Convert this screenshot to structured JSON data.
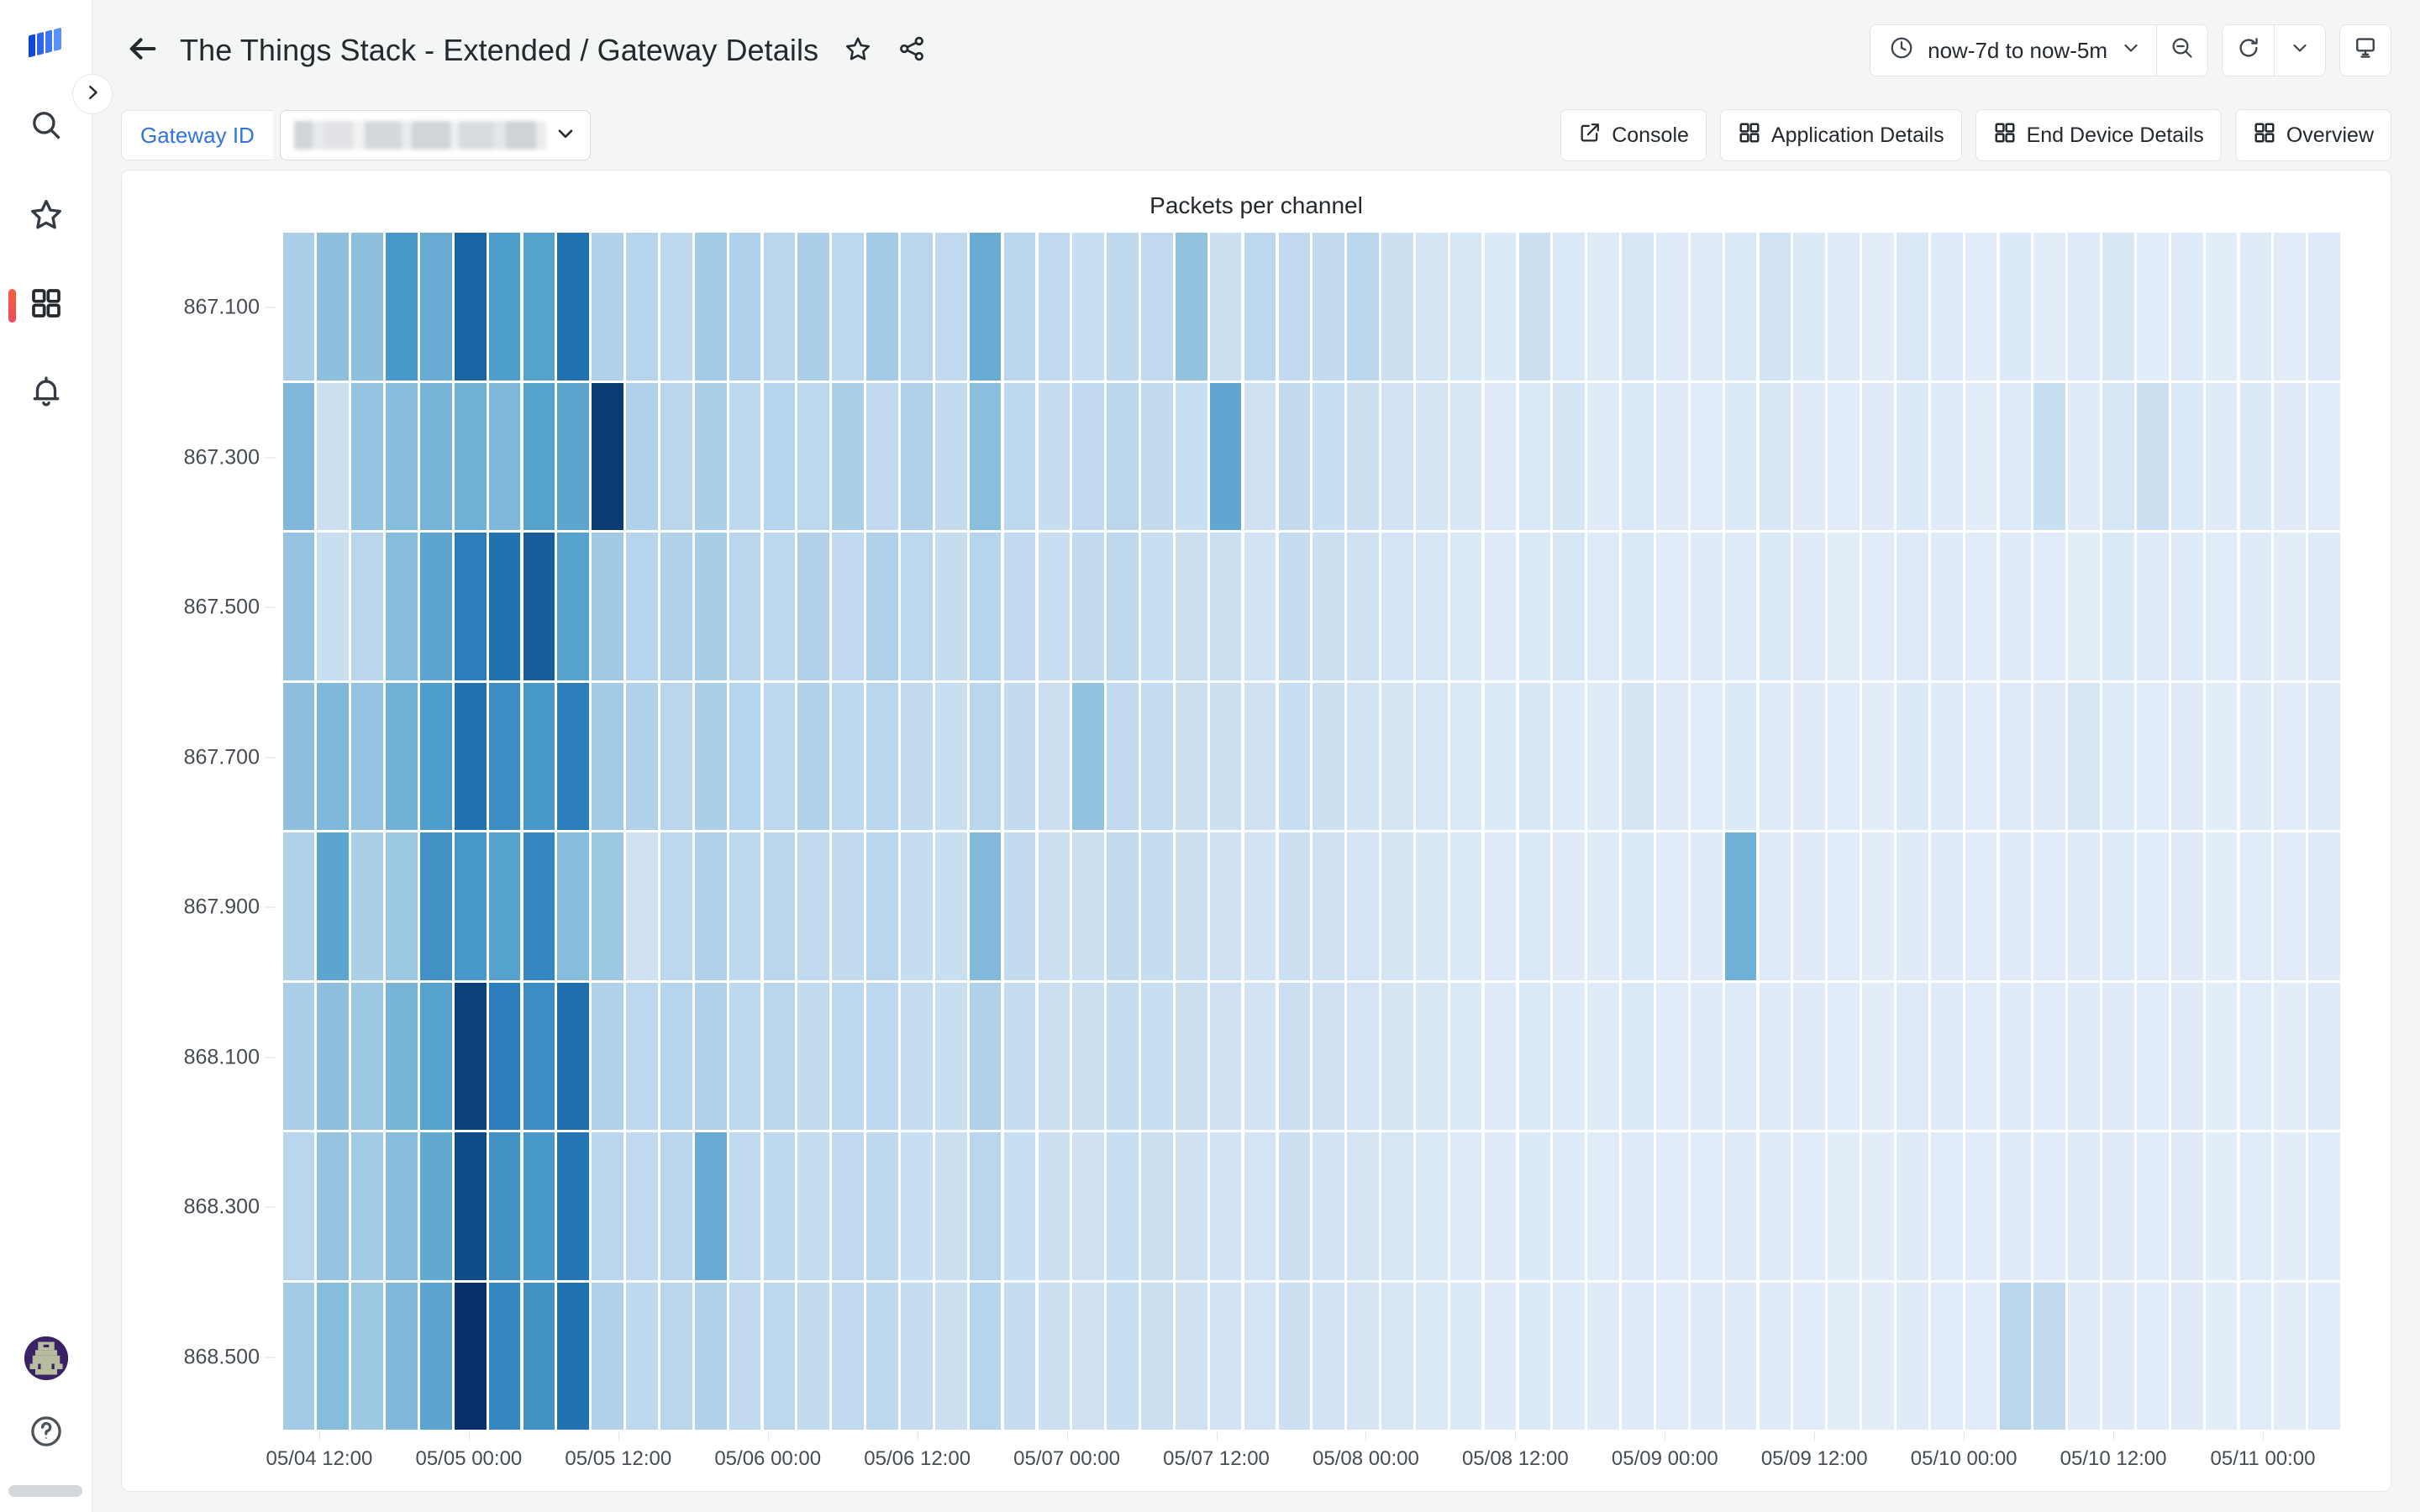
{
  "sidebar": {
    "logo": "grafana-logo",
    "items": [
      {
        "name": "search",
        "icon": "search-icon",
        "active": false
      },
      {
        "name": "starred",
        "icon": "star-icon",
        "active": false
      },
      {
        "name": "dashboards",
        "icon": "dashboards-icon",
        "active": true
      },
      {
        "name": "alerting",
        "icon": "bell-icon",
        "active": false
      }
    ],
    "bottom": [
      {
        "name": "profile",
        "icon": "avatar-icon"
      },
      {
        "name": "help",
        "icon": "help-circle-icon"
      }
    ]
  },
  "header": {
    "back_label": "back-arrow",
    "title": "The Things Stack - Extended  /  Gateway Details",
    "star_icon": "star-icon",
    "share_icon": "share-icon",
    "time_range": "now-7d to now-5m",
    "time_icon": "clock-icon",
    "time_caret": "chevron-down-icon",
    "zoom_out_icon": "zoom-out-icon",
    "refresh_icon": "refresh-icon",
    "refresh_caret": "chevron-down-icon",
    "tv_icon": "tv-mode-icon"
  },
  "toolbar": {
    "variable_label": "Gateway ID",
    "variable_value": "",
    "variable_caret": "chevron-down-icon",
    "links": [
      {
        "label": "Console",
        "icon": "external-link-icon"
      },
      {
        "label": "Application Details",
        "icon": "dashboard-grid-icon"
      },
      {
        "label": "End Device Details",
        "icon": "dashboard-grid-icon"
      },
      {
        "label": "Overview",
        "icon": "dashboard-grid-icon"
      }
    ]
  },
  "panel": {
    "title": "Packets per channel"
  },
  "chart_data": {
    "type": "heatmap",
    "title": "Packets per channel",
    "xlabel": "",
    "ylabel": "",
    "grid": false,
    "legend": "none",
    "color_scheme": "Blues",
    "color_stops": [
      "#f2f7fd",
      "#e3edf8",
      "#d2e3f3",
      "#b9d6ed",
      "#96c4e0",
      "#6fb0d6",
      "#4e9ecb",
      "#2f81bf",
      "#1e6ead",
      "#0c457f",
      "#08306b"
    ],
    "y_categories": [
      "867.100",
      "867.300",
      "867.500",
      "867.700",
      "867.900",
      "868.100",
      "868.300",
      "868.500"
    ],
    "x_tick_labels": [
      "05/04 12:00",
      "05/05 00:00",
      "05/05 12:00",
      "05/06 00:00",
      "05/06 12:00",
      "05/07 00:00",
      "05/07 12:00",
      "05/08 00:00",
      "05/08 12:00",
      "05/09 00:00",
      "05/09 12:00",
      "05/10 00:00",
      "05/10 12:00",
      "05/11 00:00"
    ],
    "x_bucket_count": 60,
    "value_unit": "packets",
    "values": [
      [
        0.34,
        0.42,
        0.42,
        0.62,
        0.52,
        0.82,
        0.6,
        0.58,
        0.78,
        0.32,
        0.31,
        0.28,
        0.36,
        0.33,
        0.3,
        0.34,
        0.29,
        0.36,
        0.3,
        0.27,
        0.52,
        0.3,
        0.27,
        0.24,
        0.28,
        0.27,
        0.41,
        0.22,
        0.29,
        0.27,
        0.26,
        0.3,
        0.22,
        0.18,
        0.17,
        0.14,
        0.22,
        0.15,
        0.12,
        0.16,
        0.13,
        0.12,
        0.15,
        0.2,
        0.14,
        0.12,
        0.1,
        0.15,
        0.13,
        0.11,
        0.14,
        0.1,
        0.13,
        0.16,
        0.11,
        0.13,
        0.1,
        0.12,
        0.11,
        0.13
      ],
      [
        0.46,
        0.22,
        0.4,
        0.44,
        0.48,
        0.5,
        0.46,
        0.58,
        0.56,
        0.95,
        0.33,
        0.3,
        0.34,
        0.28,
        0.31,
        0.29,
        0.34,
        0.27,
        0.32,
        0.26,
        0.43,
        0.29,
        0.25,
        0.27,
        0.3,
        0.26,
        0.24,
        0.55,
        0.21,
        0.26,
        0.24,
        0.22,
        0.2,
        0.18,
        0.16,
        0.13,
        0.15,
        0.18,
        0.12,
        0.15,
        0.12,
        0.11,
        0.14,
        0.16,
        0.12,
        0.11,
        0.12,
        0.14,
        0.12,
        0.1,
        0.13,
        0.24,
        0.12,
        0.17,
        0.22,
        0.14,
        0.12,
        0.14,
        0.12,
        0.11
      ],
      [
        0.4,
        0.24,
        0.3,
        0.44,
        0.56,
        0.72,
        0.78,
        0.84,
        0.58,
        0.37,
        0.31,
        0.33,
        0.35,
        0.3,
        0.28,
        0.32,
        0.27,
        0.33,
        0.29,
        0.25,
        0.31,
        0.27,
        0.24,
        0.26,
        0.28,
        0.24,
        0.23,
        0.22,
        0.2,
        0.25,
        0.22,
        0.21,
        0.19,
        0.17,
        0.15,
        0.13,
        0.14,
        0.17,
        0.13,
        0.14,
        0.11,
        0.12,
        0.13,
        0.15,
        0.12,
        0.1,
        0.11,
        0.13,
        0.12,
        0.11,
        0.12,
        0.11,
        0.1,
        0.14,
        0.12,
        0.13,
        0.11,
        0.12,
        0.1,
        0.12
      ],
      [
        0.42,
        0.46,
        0.4,
        0.5,
        0.6,
        0.78,
        0.66,
        0.62,
        0.72,
        0.36,
        0.32,
        0.3,
        0.34,
        0.31,
        0.29,
        0.33,
        0.28,
        0.3,
        0.26,
        0.24,
        0.3,
        0.26,
        0.23,
        0.41,
        0.27,
        0.25,
        0.23,
        0.22,
        0.21,
        0.24,
        0.22,
        0.2,
        0.18,
        0.17,
        0.15,
        0.14,
        0.16,
        0.13,
        0.12,
        0.18,
        0.12,
        0.11,
        0.14,
        0.13,
        0.12,
        0.11,
        0.1,
        0.14,
        0.12,
        0.11,
        0.13,
        0.12,
        0.17,
        0.13,
        0.11,
        0.12,
        0.1,
        0.12,
        0.11,
        0.12
      ],
      [
        0.32,
        0.56,
        0.34,
        0.38,
        0.64,
        0.62,
        0.58,
        0.68,
        0.44,
        0.38,
        0.21,
        0.29,
        0.32,
        0.28,
        0.3,
        0.27,
        0.26,
        0.3,
        0.25,
        0.24,
        0.45,
        0.26,
        0.23,
        0.22,
        0.26,
        0.25,
        0.22,
        0.21,
        0.2,
        0.22,
        0.21,
        0.19,
        0.18,
        0.16,
        0.14,
        0.13,
        0.15,
        0.12,
        0.12,
        0.14,
        0.11,
        0.12,
        0.5,
        0.13,
        0.12,
        0.11,
        0.1,
        0.12,
        0.12,
        0.11,
        0.12,
        0.11,
        0.12,
        0.13,
        0.11,
        0.12,
        0.1,
        0.11,
        0.11,
        0.12
      ],
      [
        0.34,
        0.42,
        0.38,
        0.48,
        0.58,
        0.92,
        0.72,
        0.66,
        0.8,
        0.33,
        0.29,
        0.31,
        0.33,
        0.28,
        0.3,
        0.26,
        0.28,
        0.29,
        0.25,
        0.24,
        0.33,
        0.25,
        0.23,
        0.22,
        0.25,
        0.24,
        0.22,
        0.21,
        0.2,
        0.23,
        0.21,
        0.19,
        0.18,
        0.16,
        0.14,
        0.13,
        0.15,
        0.13,
        0.12,
        0.14,
        0.11,
        0.12,
        0.13,
        0.12,
        0.12,
        0.11,
        0.1,
        0.13,
        0.12,
        0.11,
        0.12,
        0.11,
        0.12,
        0.12,
        0.11,
        0.12,
        0.1,
        0.11,
        0.1,
        0.12
      ],
      [
        0.3,
        0.4,
        0.36,
        0.44,
        0.54,
        0.88,
        0.64,
        0.62,
        0.76,
        0.3,
        0.27,
        0.3,
        0.52,
        0.27,
        0.28,
        0.25,
        0.27,
        0.28,
        0.24,
        0.23,
        0.3,
        0.24,
        0.22,
        0.21,
        0.24,
        0.23,
        0.21,
        0.2,
        0.19,
        0.22,
        0.2,
        0.18,
        0.17,
        0.15,
        0.13,
        0.12,
        0.14,
        0.13,
        0.11,
        0.13,
        0.11,
        0.11,
        0.12,
        0.12,
        0.11,
        0.1,
        0.1,
        0.12,
        0.11,
        0.11,
        0.12,
        0.11,
        0.12,
        0.12,
        0.11,
        0.12,
        0.1,
        0.11,
        0.1,
        0.11
      ],
      [
        0.36,
        0.44,
        0.38,
        0.46,
        0.56,
        1.0,
        0.68,
        0.64,
        0.78,
        0.32,
        0.28,
        0.3,
        0.32,
        0.27,
        0.29,
        0.26,
        0.27,
        0.28,
        0.25,
        0.23,
        0.31,
        0.25,
        0.22,
        0.21,
        0.24,
        0.23,
        0.21,
        0.2,
        0.19,
        0.22,
        0.2,
        0.18,
        0.17,
        0.15,
        0.14,
        0.12,
        0.14,
        0.13,
        0.12,
        0.13,
        0.11,
        0.12,
        0.12,
        0.12,
        0.11,
        0.1,
        0.1,
        0.12,
        0.11,
        0.11,
        0.3,
        0.26,
        0.12,
        0.12,
        0.11,
        0.12,
        0.1,
        0.11,
        0.1,
        0.11
      ]
    ]
  }
}
